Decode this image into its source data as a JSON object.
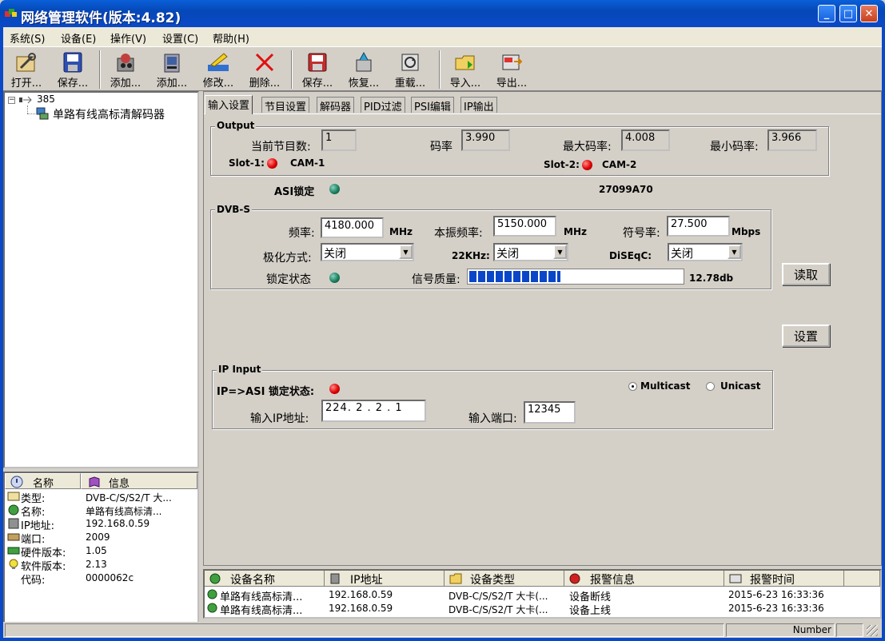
{
  "window": {
    "title": "网络管理软件(版本:4.82)",
    "btn_min": "_",
    "btn_max": "□",
    "btn_close": "✕"
  },
  "menu": [
    "系统(S)",
    "设备(E)",
    "操作(V)",
    "设置(C)",
    "帮助(H)"
  ],
  "toolbar": [
    {
      "label": "打开...",
      "icon": "open-wrench-icon"
    },
    {
      "label": "保存...",
      "icon": "save-disk-icon"
    },
    {
      "label": "添加...",
      "icon": "add-device-icon"
    },
    {
      "label": "添加...",
      "icon": "add-module-icon"
    },
    {
      "label": "修改...",
      "icon": "edit-pencil-icon"
    },
    {
      "label": "删除...",
      "icon": "delete-x-icon"
    },
    {
      "label": "保存...",
      "icon": "save-config-icon"
    },
    {
      "label": "恢复...",
      "icon": "restore-icon"
    },
    {
      "label": "重载...",
      "icon": "reload-icon"
    },
    {
      "label": "导入...",
      "icon": "import-folder-icon"
    },
    {
      "label": "导出...",
      "icon": "export-icon"
    }
  ],
  "tree": {
    "root": "385",
    "child": "单路有线高标清解码器"
  },
  "info": {
    "col_name": "名称",
    "col_info": "信息",
    "rows": [
      {
        "name": "类型:",
        "value": "DVB-C/S/S2/T 大..."
      },
      {
        "name": "名称:",
        "value": "单路有线高标清..."
      },
      {
        "name": "IP地址:",
        "value": "192.168.0.59"
      },
      {
        "name": "端口:",
        "value": "2009"
      },
      {
        "name": "硬件版本:",
        "value": "1.05"
      },
      {
        "name": "软件版本:",
        "value": "2.13"
      },
      {
        "name": "代码:",
        "value": "0000062c"
      }
    ]
  },
  "tabs": [
    "输入设置",
    "节目设置",
    "解码器",
    "PID过滤",
    "PSI编辑",
    "IP输出"
  ],
  "output": {
    "title": "Output",
    "programs_label": "当前节目数:",
    "programs": "1",
    "bitrate_label": "码率",
    "bitrate": "3.990",
    "max_label": "最大码率:",
    "max": "4.008",
    "min_label": "最小码率:",
    "min": "3.966",
    "slot1_label": "Slot-1:",
    "slot1_value": "CAM-1",
    "slot2_label": "Slot-2:",
    "slot2_value": "CAM-2"
  },
  "asi": {
    "label": "ASI锁定",
    "code": "27099A70"
  },
  "dvbs": {
    "title": "DVB-S",
    "freq_label": "频率:",
    "freq": "4180.000",
    "freq_unit": "MHz",
    "lo_label": "本振频率:",
    "lo": "5150.000",
    "lo_unit": "MHz",
    "sr_label": "符号率:",
    "sr": "27.500",
    "sr_unit": "Mbps",
    "pol_label": "极化方式:",
    "pol": "关闭",
    "k22_label": "22KHz:",
    "k22": "关闭",
    "diseqc_label": "DiSEqC:",
    "diseqc": "关闭",
    "lock_label": "锁定状态",
    "quality_label": "信号质量:",
    "quality_text": "12.78db",
    "quality_fill": 0.43
  },
  "buttons": {
    "read": "读取",
    "set": "设置"
  },
  "ip_input": {
    "title": "IP Input",
    "lock_label": "IP=>ASI 锁定状态:",
    "multicast": "Multicast",
    "unicast": "Unicast",
    "ip_label": "输入IP地址:",
    "ip": "224. 2 . 2 . 1",
    "port_label": "输入端口:",
    "port": "12345"
  },
  "alarms": {
    "headers": [
      "设备名称",
      "IP地址",
      "设备类型",
      "报警信息",
      "报警时间"
    ],
    "rows": [
      [
        "单路有线高标清...",
        "192.168.0.59",
        "DVB-C/S/S2/T 大卡(...",
        "设备断线",
        "2015-6-23 16:33:36"
      ],
      [
        "单路有线高标清...",
        "192.168.0.59",
        "DVB-C/S/S2/T 大卡(...",
        "设备上线",
        "2015-6-23 16:33:36"
      ]
    ]
  },
  "status": {
    "num": "Number"
  },
  "colors": {
    "titlebar": "#0548b8",
    "menubar": "#ece9d8",
    "face": "#d4d0c8",
    "meter": "#0a46c8",
    "led_red": "#e00000",
    "led_green": "#1a8060"
  }
}
